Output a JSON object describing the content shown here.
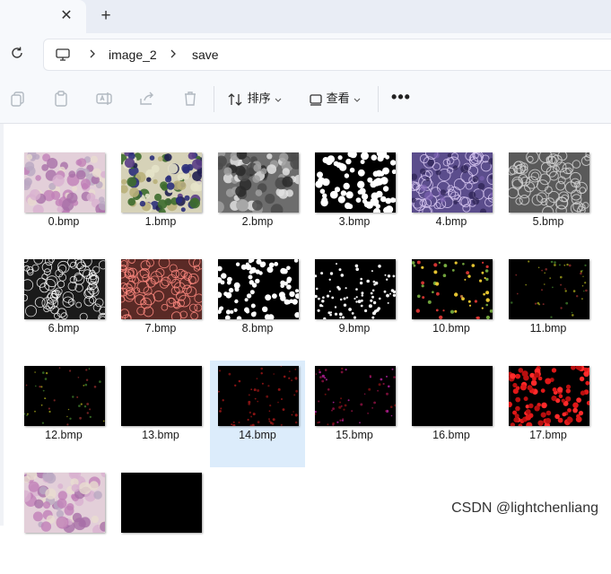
{
  "tabs": {
    "close_glyph": "✕",
    "new_tab_glyph": "+"
  },
  "breadcrumb": {
    "items": [
      "image_2",
      "save"
    ]
  },
  "toolbar": {
    "sort_label": "排序",
    "view_label": "查看",
    "more_glyph": "•••"
  },
  "files": [
    {
      "name": "0.bmp",
      "thumb": "histo"
    },
    {
      "name": "1.bmp",
      "thumb": "colorful"
    },
    {
      "name": "2.bmp",
      "thumb": "gray"
    },
    {
      "name": "3.bmp",
      "thumb": "binary"
    },
    {
      "name": "4.bmp",
      "thumb": "purple"
    },
    {
      "name": "5.bmp",
      "thumb": "gray-edge"
    },
    {
      "name": "6.bmp",
      "thumb": "white-edge"
    },
    {
      "name": "7.bmp",
      "thumb": "red-edge"
    },
    {
      "name": "8.bmp",
      "thumb": "white-dots"
    },
    {
      "name": "9.bmp",
      "thumb": "white-dots-small"
    },
    {
      "name": "10.bmp",
      "thumb": "rg-dots"
    },
    {
      "name": "11.bmp",
      "thumb": "rg-dots-faint"
    },
    {
      "name": "12.bmp",
      "thumb": "rg-dots-faint"
    },
    {
      "name": "13.bmp",
      "thumb": "black"
    },
    {
      "name": "14.bmp",
      "thumb": "red-dots-faint"
    },
    {
      "name": "15.bmp",
      "thumb": "pink-dots-faint"
    },
    {
      "name": "16.bmp",
      "thumb": "black"
    },
    {
      "name": "17.bmp",
      "thumb": "red-dots"
    },
    {
      "name": "",
      "thumb": "histo"
    },
    {
      "name": "",
      "thumb": "black"
    }
  ],
  "selected_index": 14,
  "watermark": "CSDN @lightchenliang",
  "colors": {
    "selection": "#dcecfb",
    "chrome": "#f7f9fc",
    "tabstrip": "#e9edf5"
  }
}
